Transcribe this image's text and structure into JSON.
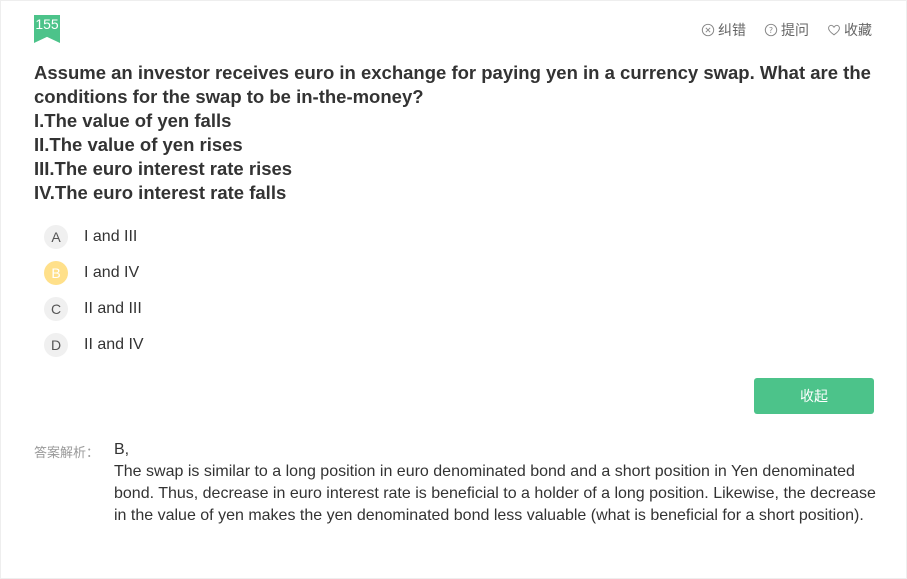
{
  "question": {
    "number": "155",
    "stem_lines": [
      "Assume an investor receives euro in exchange for paying yen in a currency swap. What are the conditions for the swap to be in-the-money?",
      "I.The value of yen falls",
      "II.The value of yen rises",
      "III.The euro interest rate rises",
      "IV.The euro interest rate falls"
    ]
  },
  "actions": [
    {
      "icon": "x-circle-icon",
      "label": "纠错"
    },
    {
      "icon": "question-circle-icon",
      "label": "提问"
    },
    {
      "icon": "heart-icon",
      "label": "收藏"
    }
  ],
  "options": [
    {
      "letter": "A",
      "text": "I and III",
      "selected": false
    },
    {
      "letter": "B",
      "text": "I and IV",
      "selected": true
    },
    {
      "letter": "C",
      "text": "II and III",
      "selected": false
    },
    {
      "letter": "D",
      "text": "II and IV",
      "selected": false
    }
  ],
  "collapse_label": "收起",
  "analysis": {
    "label": "答案解析：",
    "answer": "B,",
    "text": "The swap is similar to a long position in euro denominated bond and a short position in Yen denominated bond. Thus, decrease in euro interest rate is beneficial to a holder of a long position. Likewise, the decrease in the value of yen makes the yen denominated bond less valuable (what is beneficial for a short position)."
  },
  "colors": {
    "accent": "#4cc38a",
    "selected_option": "#ffe08a"
  }
}
